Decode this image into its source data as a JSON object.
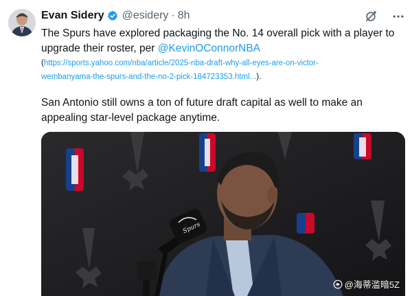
{
  "author": {
    "name": "Evan Sidery",
    "handle": "@esidery",
    "separator": "·",
    "time": "8h",
    "verified_color": "#1d9bf0"
  },
  "actions": {
    "mute_icon": "no-notifications-icon",
    "more_icon": "more-dots-icon"
  },
  "tweet": {
    "line1": "The Spurs have explored packaging the No. 14 overall pick with a player to",
    "line2_prefix": "upgrade their roster, per ",
    "mention": "@KevinOConnorNBA",
    "paren_open": "(",
    "link_part1": "https://sports.yahoo.com/nba/article/2025-nba-draft-why-all-eyes-are-on-victor-",
    "link_part2": "wembanyama-the-spurs-and-the-no-2-pick-184723353.html...",
    "paren_close": ").",
    "para2_line1": "San Antonio still owns a ton of future draft capital as well to make an",
    "para2_line2": "appealing star-level package anytime."
  },
  "media": {
    "description_icon": "press-conference-photo",
    "mic_label": "Spurs"
  },
  "watermark": {
    "text": "@海蒂滥暗5Z"
  },
  "colors": {
    "link": "#1d9bf0",
    "text": "#0f1419",
    "muted": "#536471"
  }
}
